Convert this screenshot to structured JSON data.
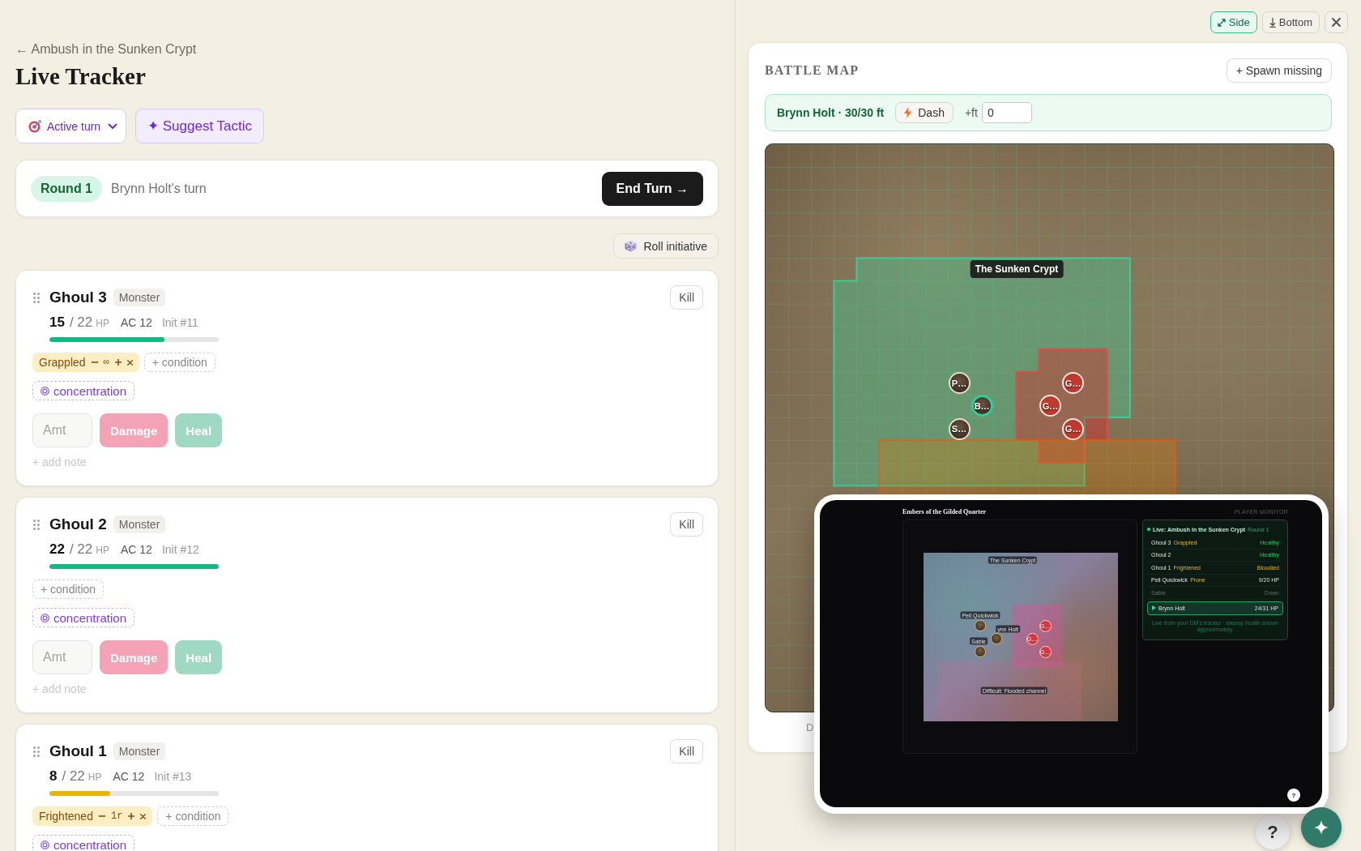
{
  "header": {
    "back_link": "← Ambush in the Sunken Crypt",
    "title": "Live Tracker"
  },
  "toolbar": {
    "view_select": "Active turn",
    "suggest_button": "✦ Suggest Tactic"
  },
  "round_bar": {
    "round": "Round 1",
    "turn": "Brynn Holt's turn",
    "end_turn_button": "End Turn →"
  },
  "roll_button": "Roll initiative",
  "combatants": [
    {
      "name": "Ghoul 3",
      "type": "Monster",
      "kill_button": "Kill",
      "hp": "15",
      "hp_max": "/ 22",
      "hp_unit": "HP",
      "ac": "AC 12",
      "init": "Init #11",
      "hp_bar": {
        "level": 0.68,
        "color": "#10b981"
      },
      "conditions": [
        {
          "name": "Grappled",
          "duration": "∞"
        }
      ],
      "add_condition": "+ condition",
      "concentration": "concentration",
      "amount_placeholder": "Amt",
      "damage_button": {
        "label": "Damage",
        "disabled": true
      },
      "heal_button": {
        "label": "Heal",
        "disabled": true
      },
      "note": "+ add note"
    },
    {
      "name": "Ghoul 2",
      "type": "Monster",
      "kill_button": "Kill",
      "hp": "22",
      "hp_max": "/ 22",
      "hp_unit": "HP",
      "ac": "AC 12",
      "init": "Init #12",
      "hp_bar": {
        "level": 1,
        "color": "#10b981"
      },
      "add_condition": "+ condition",
      "concentration": "concentration",
      "amount_placeholder": "Amt",
      "damage_button": {
        "label": "Damage",
        "disabled": true
      },
      "heal_button": {
        "label": "Heal",
        "disabled": true
      },
      "note": "+ add note"
    },
    {
      "name": "Ghoul 1",
      "type": "Monster",
      "kill_button": "Kill",
      "hp": "8",
      "hp_max": "/ 22",
      "hp_unit": "HP",
      "ac": "AC 12",
      "init": "Init #13",
      "hp_bar": {
        "level": 0.36,
        "color": "#eab308"
      },
      "conditions": [
        {
          "name": "Frightened",
          "duration": "1r"
        }
      ],
      "add_condition": "+ condition",
      "concentration": "concentration"
    }
  ],
  "layout_buttons": [
    {
      "label": "Side",
      "selected": true
    },
    {
      "label": "Bottom",
      "selected": false
    }
  ],
  "battle_map": {
    "title": "BATTLE MAP",
    "spawn_button": "+ Spawn missing",
    "movement": {
      "label": "Brynn Holt · 30/30 ft",
      "dash_button": "Dash",
      "extra_label": "+ft",
      "extra_value": "0"
    },
    "areas": [
      {
        "kind": "reach"
      },
      {
        "kind": "threat"
      },
      {
        "kind": "difficult"
      }
    ],
    "area_label": "The Sunken Crypt",
    "tokens": [
      {
        "label": "P…",
        "kind": "player",
        "selected": false
      },
      {
        "label": "B…",
        "kind": "player",
        "selected": true
      },
      {
        "label": "S…",
        "kind": "player",
        "selected": false
      },
      {
        "label": "G…",
        "kind": "monster",
        "selected": false
      },
      {
        "label": "G…",
        "kind": "monster",
        "selected": false
      },
      {
        "label": "G…",
        "kind": "monster",
        "selected": false
      }
    ],
    "legend": "D"
  },
  "player_monitor": {
    "title": "Embers of the Gilded Quarter",
    "badge": "PLAYER MONITOR",
    "preview": {
      "area_label": "The Sunken Crypt",
      "terrain_label": "Difficult: Flooded channel",
      "tokens": [
        {
          "kind": "player",
          "name_tag": "Pell Quickwick"
        },
        {
          "kind": "player",
          "name_tag": "ynn Holt"
        },
        {
          "kind": "player",
          "name_tag": "Sable"
        },
        {
          "kind": "monster",
          "label": "G…"
        },
        {
          "kind": "monster",
          "label": "G…"
        },
        {
          "kind": "monster",
          "label": "G…"
        }
      ]
    },
    "tracker": {
      "live": "Live: Ambush in the Sunken Crypt",
      "round": "Round 1",
      "rows": [
        {
          "name": "Ghoul 3",
          "condition": "Grappled",
          "status": "Healthy",
          "kind": "healthy",
          "selected": false
        },
        {
          "name": "Ghoul 2",
          "status": "Healthy",
          "kind": "healthy",
          "selected": false
        },
        {
          "name": "Ghoul 1",
          "condition": "Frightened",
          "status": "Bloodied",
          "kind": "bloodied",
          "selected": false
        },
        {
          "name": "Pell Quickwick",
          "condition": "Prone",
          "status": "9/20 HP",
          "kind": "hp",
          "selected": false
        },
        {
          "name": "Sable",
          "status": "Down",
          "kind": "down",
          "selected": false
        },
        {
          "name": "Brynn Holt",
          "status": "24/31 HP",
          "kind": "hp",
          "selected": true
        }
      ],
      "footer": "Live from your DM's tracker · enemy health shown approximately."
    },
    "help_button": "?"
  },
  "help_button": "?"
}
